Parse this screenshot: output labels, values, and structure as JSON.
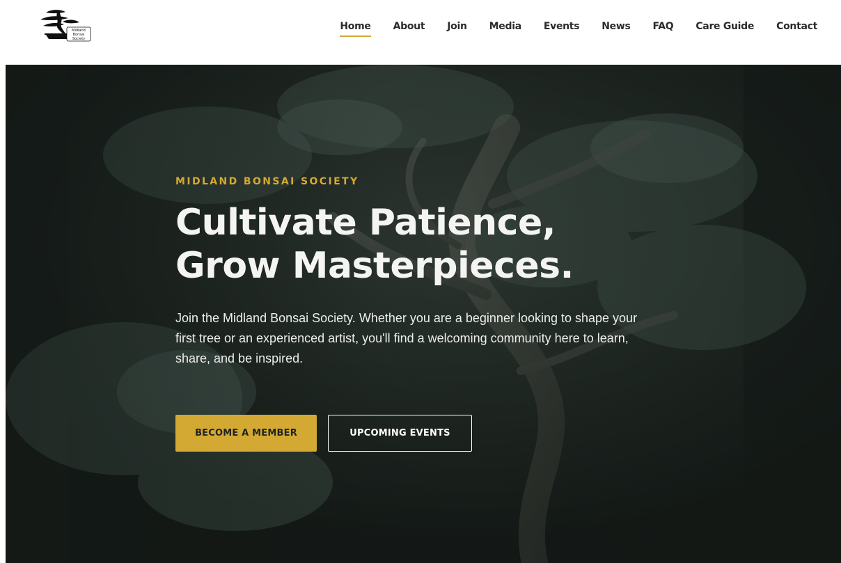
{
  "header": {
    "logo_icon": "bonsai-tree-logo",
    "logo_text": [
      "Midland",
      "Bonsai",
      "Society"
    ]
  },
  "nav": {
    "items": [
      {
        "label": "Home",
        "active": true
      },
      {
        "label": "About"
      },
      {
        "label": "Join"
      },
      {
        "label": "Media"
      },
      {
        "label": "Events"
      },
      {
        "label": "News"
      },
      {
        "label": "FAQ"
      },
      {
        "label": "Care Guide"
      },
      {
        "label": "Contact"
      }
    ]
  },
  "hero": {
    "eyebrow": "MIDLAND BONSAI SOCIETY",
    "headline_line1": "Cultivate Patience,",
    "headline_line2": "Grow Masterpieces.",
    "description": "Join the Midland Bonsai Society. Whether you are a beginner looking to shape your first tree or an experienced artist, you'll find a welcoming community here to learn, share, and be inspired.",
    "primary_button": "BECOME A MEMBER",
    "secondary_button": "UPCOMING EVENTS"
  },
  "colors": {
    "accent": "#d4a933",
    "hero_dark": "#1d2420",
    "text_light": "#f4f4f2",
    "nav_text": "#2b2b2b"
  }
}
